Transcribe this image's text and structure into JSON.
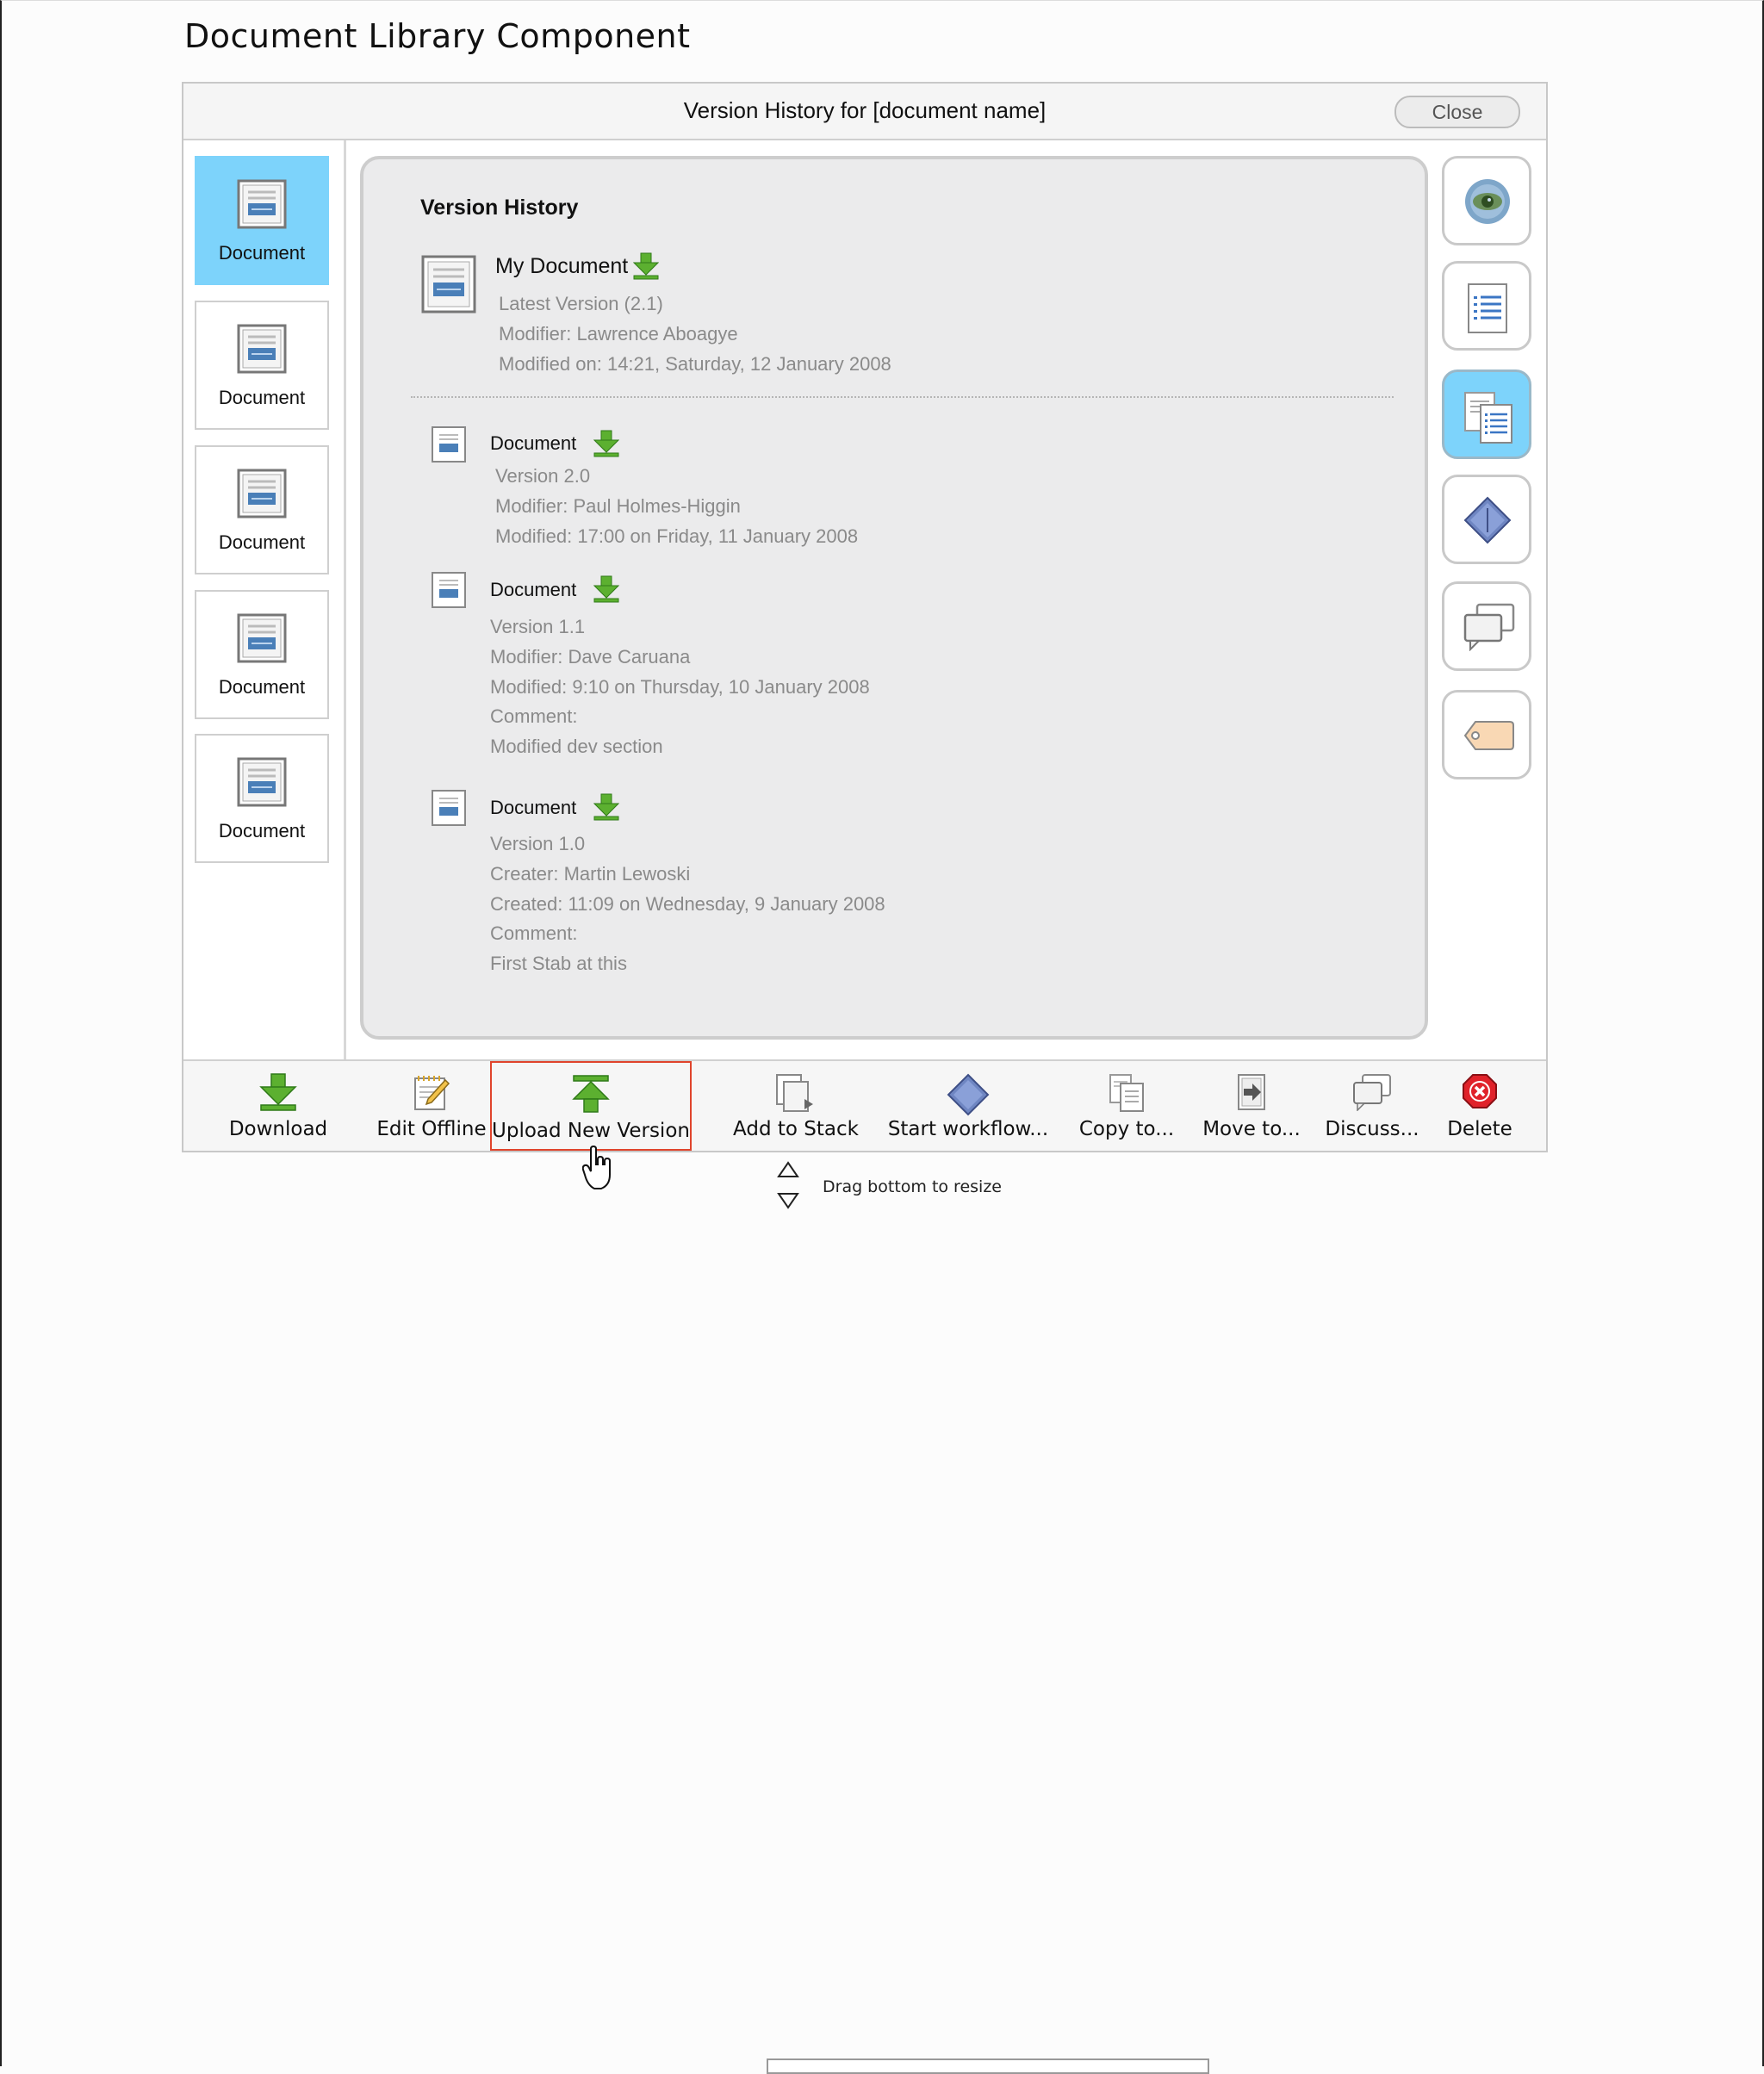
{
  "page": {
    "title": "Document Library Component"
  },
  "dialog": {
    "title": "Version History for [document name]",
    "close_label": "Close"
  },
  "thumbnails": [
    {
      "label": "Document",
      "selected": true
    },
    {
      "label": "Document",
      "selected": false
    },
    {
      "label": "Document",
      "selected": false
    },
    {
      "label": "Document",
      "selected": false
    },
    {
      "label": "Document",
      "selected": false
    }
  ],
  "version_history": {
    "heading": "Version History",
    "latest": {
      "name": "My Document",
      "lines": [
        "Latest Version (2.1)",
        "Modifier: Lawrence Aboagye",
        "Modified on: 14:21, Saturday, 12 January 2008"
      ]
    },
    "versions": [
      {
        "name": "Document",
        "lines": [
          "Version 2.0",
          "Modifier: Paul Holmes-Higgin",
          "Modified: 17:00 on Friday, 11 January 2008"
        ]
      },
      {
        "name": "Document",
        "lines": [
          "Version 1.1",
          "Modifier: Dave Caruana",
          "Modified: 9:10 on Thursday, 10 January 2008",
          "Comment:",
          "Modified dev section"
        ]
      },
      {
        "name": "Document",
        "lines": [
          "Version 1.0",
          "Creater: Martin Lewoski",
          "Created: 11:09 on Wednesday, 9 January 2008",
          "Comment:",
          "First Stab at this"
        ]
      }
    ]
  },
  "right_rail": [
    {
      "icon": "eye-icon",
      "active": false
    },
    {
      "icon": "document-details-icon",
      "active": false
    },
    {
      "icon": "versions-icon",
      "active": true
    },
    {
      "icon": "workflow-icon",
      "active": false
    },
    {
      "icon": "discussion-icon",
      "active": false
    },
    {
      "icon": "tag-icon",
      "active": false
    }
  ],
  "toolbar": {
    "download": "Download",
    "edit_offline": "Edit Offline",
    "upload_new_version": "Upload New Version",
    "add_to_stack": "Add to Stack",
    "start_workflow": "Start workflow...",
    "copy_to": "Copy to...",
    "move_to": "Move to...",
    "discuss": "Discuss...",
    "delete": "Delete"
  },
  "resize_hint": "Drag bottom to resize",
  "colors": {
    "selected": "#7dd3fb",
    "highlight": "#e0442c",
    "download_green": "#5cb030"
  }
}
